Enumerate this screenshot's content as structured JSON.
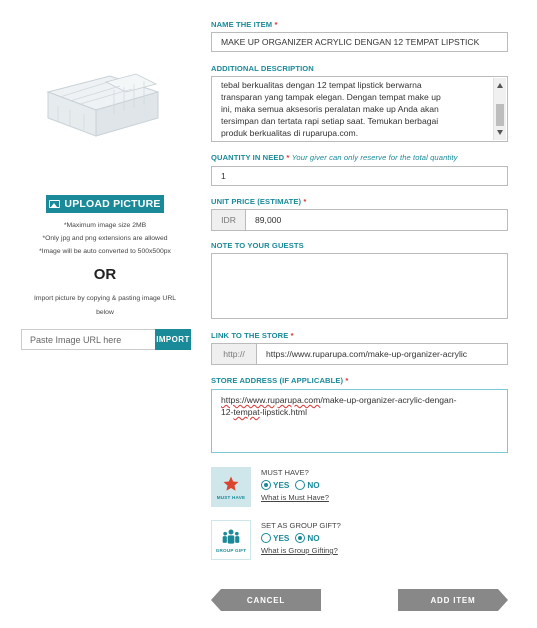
{
  "left": {
    "upload_label": "UPLOAD PICTURE",
    "rules": [
      "*Maximum image size 2MB",
      "*Only jpg and png extensions are allowed",
      "*Image will be auto converted to 500x500px"
    ],
    "or": "OR",
    "import_note": "Import picture by copying & pasting image URL below",
    "url_placeholder": "Paste Image URL here",
    "import_label": "IMPORT"
  },
  "form": {
    "name_label": "NAME THE ITEM",
    "name_value": "MAKE UP ORGANIZER ACRYLIC DENGAN 12 TEMPAT LIPSTICK",
    "desc_label": "ADDITIONAL DESCRIPTION",
    "desc_lines": [
      "tebal berkualitas dengan 12 tempat lipstick berwarna",
      "transparan yang tampak elegan. Dengan tempat make up",
      "ini, maka semua aksesoris peralatan make up Anda akan",
      "tersimpan dan tertata rapi setiap saat. Temukan berbagai",
      "produk berkualitas di ruparupa.com."
    ],
    "qty_label": "QUANTITY IN NEED",
    "qty_hint": "Your giver can only reserve for the total quantity",
    "qty_value": "1",
    "price_label": "UNIT PRICE (ESTIMATE)",
    "currency": "IDR",
    "price_value": "89,000",
    "note_label": "NOTE TO YOUR GUESTS",
    "note_value": "",
    "link_label": "LINK TO THE STORE",
    "link_prefix": "http://",
    "link_value": "https://www.ruparupa.com/make-up-organizer-acrylic",
    "address_label": "STORE ADDRESS (IF APPLICABLE)",
    "address_link": "https://www.ruparupa.com",
    "address_rest": "/make-up-organizer-acrylic-dengan-",
    "address_line2_a": "12-",
    "address_line2_b": "tempat",
    "address_line2_c": "-lipstick.html",
    "required_mark": "*"
  },
  "must_have": {
    "icon_caption": "MUST HAVE",
    "title": "MUST HAVE?",
    "yes": "YES",
    "no": "NO",
    "selected": "YES",
    "link": "What is Must Have?"
  },
  "group_gift": {
    "icon_caption": "GROUP GIFT",
    "title": "SET AS GROUP GIFT?",
    "yes": "YES",
    "no": "NO",
    "selected": "NO",
    "link": "What is Group Gifting?"
  },
  "buttons": {
    "cancel": "CANCEL",
    "add": "ADD ITEM"
  },
  "colors": {
    "accent": "#1a8a99",
    "required": "#d33333",
    "button_gray": "#888888"
  }
}
